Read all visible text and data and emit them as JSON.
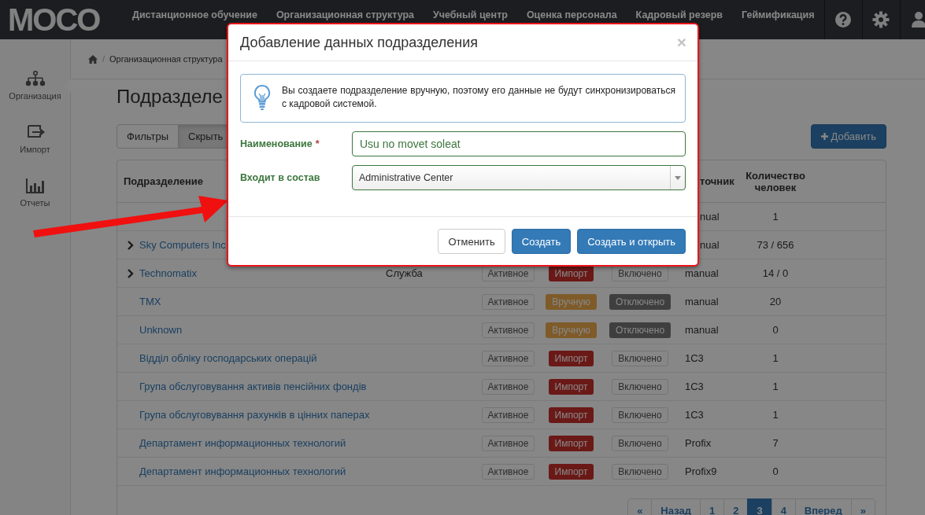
{
  "logo": "MOCO",
  "nav": {
    "items": [
      "Дистанционное обучение",
      "Организационная структура",
      "Учебный центр",
      "Оценка персонала",
      "Кадровый резерв",
      "Геймификация"
    ]
  },
  "sidebar": {
    "items": [
      {
        "label": "Организация",
        "selected": true
      },
      {
        "label": "Импорт",
        "selected": false
      },
      {
        "label": "Отчеты",
        "selected": false
      }
    ]
  },
  "breadcrumb": {
    "separator": "/",
    "items": [
      "Организационная структура"
    ]
  },
  "page_title": "Подразделе",
  "toolbar": {
    "toggles": [
      {
        "label": "Фильтры",
        "selected": false
      },
      {
        "label": "Скрыть",
        "selected": true
      }
    ],
    "add_button": "Добавить"
  },
  "table": {
    "columns": {
      "name": "Подразделение",
      "source": "точник",
      "count": "Количество человек"
    },
    "rows": [
      {
        "has_children": false,
        "source": "nual",
        "count": "1"
      },
      {
        "name": "Sky Computers Inc",
        "has_children": true,
        "source": "nual",
        "count": "73 / 656"
      },
      {
        "name": "Technomatix",
        "has_children": true,
        "type": "Служба",
        "state": "Активное",
        "origin": {
          "text": "Импорт",
          "kind": "import"
        },
        "sync": {
          "text": "Включено",
          "kind": "on"
        },
        "source": "manual",
        "count": "14 / 0"
      },
      {
        "name": "TMX",
        "has_children": false,
        "state": "Активное",
        "origin": {
          "text": "Вручную",
          "kind": "manual"
        },
        "sync": {
          "text": "Отключено",
          "kind": "off"
        },
        "source": "manual",
        "count": "20"
      },
      {
        "name": "Unknown",
        "has_children": false,
        "state": "Активное",
        "origin": {
          "text": "Вручную",
          "kind": "manual"
        },
        "sync": {
          "text": "Отключено",
          "kind": "off"
        },
        "source": "manual",
        "count": "0"
      },
      {
        "name": "Відділ обліку господарських операцій",
        "has_children": false,
        "state": "Активное",
        "origin": {
          "text": "Импорт",
          "kind": "import"
        },
        "sync": {
          "text": "Включено",
          "kind": "on"
        },
        "source": "1C3",
        "count": "1"
      },
      {
        "name": "Група обслуговування активів пенсійних фондів",
        "has_children": false,
        "state": "Активное",
        "origin": {
          "text": "Импорт",
          "kind": "import"
        },
        "sync": {
          "text": "Включено",
          "kind": "on"
        },
        "source": "1C3",
        "count": "1"
      },
      {
        "name": "Група обслуговування рахунків в цінних паперах",
        "has_children": false,
        "state": "Активное",
        "origin": {
          "text": "Импорт",
          "kind": "import"
        },
        "sync": {
          "text": "Включено",
          "kind": "on"
        },
        "source": "1C3",
        "count": "1"
      },
      {
        "name": "Департамент информационных технологий",
        "has_children": false,
        "state": "Активное",
        "origin": {
          "text": "Импорт",
          "kind": "import"
        },
        "sync": {
          "text": "Включено",
          "kind": "on"
        },
        "source": "Profix",
        "count": "7"
      },
      {
        "name": "Департамент информационных технологий",
        "has_children": false,
        "state": "Активное",
        "origin": {
          "text": "Импорт",
          "kind": "import"
        },
        "sync": {
          "text": "Включено",
          "kind": "on"
        },
        "source": "Profix9",
        "count": "0"
      }
    ]
  },
  "pagination": [
    {
      "label": "«",
      "selected": false
    },
    {
      "label": "Назад",
      "selected": false
    },
    {
      "label": "1",
      "selected": false
    },
    {
      "label": "2",
      "selected": false
    },
    {
      "label": "3",
      "selected": true
    },
    {
      "label": "4",
      "selected": false
    },
    {
      "label": "Вперед",
      "selected": false
    },
    {
      "label": "»",
      "selected": false
    }
  ],
  "modal": {
    "title": "Добавление данных подразделения",
    "close": "×",
    "notice": "Вы создаете подразделение вручную, поэтому его данные не будут синхронизироваться с кадровой системой.",
    "fields": [
      {
        "label": "Наименование",
        "required": true,
        "required_mark": "*",
        "kind": "text",
        "value": "Usu no movet soleat"
      },
      {
        "label": "Входит в состав",
        "kind": "select",
        "value": "Administrative Center"
      }
    ],
    "buttons": [
      {
        "label": "Отменить",
        "kind": "default"
      },
      {
        "label": "Создать",
        "kind": "primary"
      },
      {
        "label": "Создать и открыть",
        "kind": "primary"
      }
    ]
  }
}
